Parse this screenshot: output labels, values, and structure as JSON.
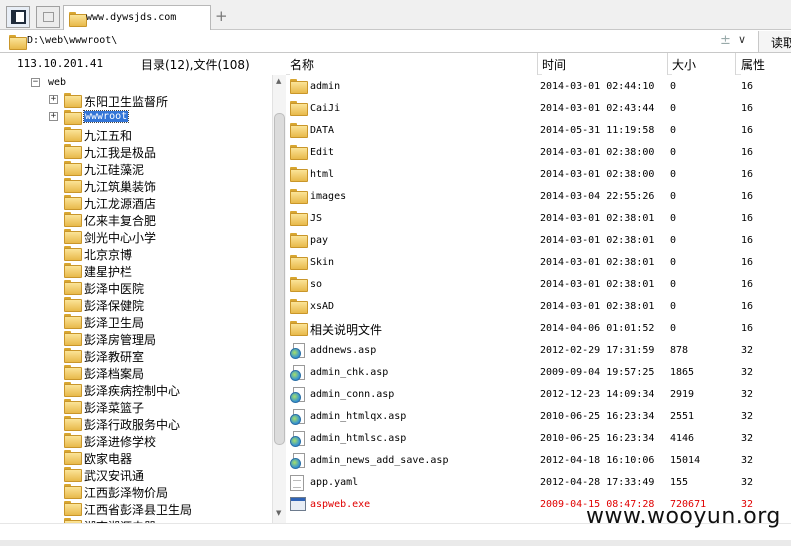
{
  "tab": {
    "title": "www.dywsjds.com",
    "add_symbol": "+"
  },
  "address": {
    "path": "D:\\web\\wwwroot\\",
    "pin_symbol": "±",
    "dropdown_symbol": "∨",
    "read_label": "读取"
  },
  "status": {
    "ip": "113.10.201.41",
    "summary": "目录(12),文件(108)"
  },
  "columns": {
    "name": "名称",
    "time": "时间",
    "size": "大小",
    "attr": "属性"
  },
  "tree": {
    "root": {
      "label": "web",
      "expander": "−"
    },
    "items": [
      {
        "label": "东阳卫生监督所",
        "expander": "+"
      },
      {
        "label": "wwwroot",
        "expander": "+",
        "selected": true
      },
      {
        "label": "九江五和"
      },
      {
        "label": "九江我是极品"
      },
      {
        "label": "九江硅藻泥"
      },
      {
        "label": "九江筑巢装饰"
      },
      {
        "label": "九江龙源酒店"
      },
      {
        "label": "亿来丰复合肥"
      },
      {
        "label": "剑光中心小学"
      },
      {
        "label": "北京京博"
      },
      {
        "label": "建星护栏"
      },
      {
        "label": "彭泽中医院"
      },
      {
        "label": "彭泽保健院"
      },
      {
        "label": "彭泽卫生局"
      },
      {
        "label": "彭泽房管理局"
      },
      {
        "label": "彭泽教研室"
      },
      {
        "label": "彭泽档案局"
      },
      {
        "label": "彭泽疾病控制中心"
      },
      {
        "label": "彭泽菜篮子"
      },
      {
        "label": "彭泽行政服务中心"
      },
      {
        "label": "彭泽进修学校"
      },
      {
        "label": "欧家电器"
      },
      {
        "label": "武汉安讯通"
      },
      {
        "label": "江西彭泽物价局"
      },
      {
        "label": "江西省彭泽县卫生局"
      },
      {
        "label": "湖南湘源电器"
      }
    ]
  },
  "files": [
    {
      "icon": "folder-icon",
      "name": "admin",
      "time": "2014-03-01 02:44:10",
      "size": "0",
      "attr": "16"
    },
    {
      "icon": "folder-icon",
      "name": "CaiJi",
      "time": "2014-03-01 02:43:44",
      "size": "0",
      "attr": "16"
    },
    {
      "icon": "folder-icon",
      "name": "DATA",
      "time": "2014-05-31 11:19:58",
      "size": "0",
      "attr": "16"
    },
    {
      "icon": "folder-icon",
      "name": "Edit",
      "time": "2014-03-01 02:38:00",
      "size": "0",
      "attr": "16"
    },
    {
      "icon": "folder-icon",
      "name": "html",
      "time": "2014-03-01 02:38:00",
      "size": "0",
      "attr": "16"
    },
    {
      "icon": "folder-icon",
      "name": "images",
      "time": "2014-03-04 22:55:26",
      "size": "0",
      "attr": "16"
    },
    {
      "icon": "folder-icon",
      "name": "JS",
      "time": "2014-03-01 02:38:01",
      "size": "0",
      "attr": "16"
    },
    {
      "icon": "folder-icon",
      "name": "pay",
      "time": "2014-03-01 02:38:01",
      "size": "0",
      "attr": "16"
    },
    {
      "icon": "folder-icon",
      "name": "Skin",
      "time": "2014-03-01 02:38:01",
      "size": "0",
      "attr": "16"
    },
    {
      "icon": "folder-icon",
      "name": "so",
      "time": "2014-03-01 02:38:01",
      "size": "0",
      "attr": "16"
    },
    {
      "icon": "folder-icon",
      "name": "xsAD",
      "time": "2014-03-01 02:38:01",
      "size": "0",
      "attr": "16"
    },
    {
      "icon": "folder-icon",
      "name": "相关说明文件",
      "time": "2014-04-06 01:01:52",
      "size": "0",
      "attr": "16",
      "cn": true
    },
    {
      "icon": "asp-file-icon",
      "name": "addnews.asp",
      "time": "2012-02-29 17:31:59",
      "size": "878",
      "attr": "32"
    },
    {
      "icon": "asp-file-icon",
      "name": "admin_chk.asp",
      "time": "2009-09-04 19:57:25",
      "size": "1865",
      "attr": "32"
    },
    {
      "icon": "asp-file-icon",
      "name": "admin_conn.asp",
      "time": "2012-12-23 14:09:34",
      "size": "2919",
      "attr": "32"
    },
    {
      "icon": "asp-file-icon",
      "name": "admin_htmlqx.asp",
      "time": "2010-06-25 16:23:34",
      "size": "2551",
      "attr": "32"
    },
    {
      "icon": "asp-file-icon",
      "name": "admin_htmlsc.asp",
      "time": "2010-06-25 16:23:34",
      "size": "4146",
      "attr": "32"
    },
    {
      "icon": "asp-file-icon",
      "name": "admin_news_add_save.asp",
      "time": "2012-04-18 16:10:06",
      "size": "15014",
      "attr": "32"
    },
    {
      "icon": "text-file-icon",
      "name": "app.yaml",
      "time": "2012-04-28 17:33:49",
      "size": "155",
      "attr": "32"
    },
    {
      "icon": "exe-file-icon",
      "name": "aspweb.exe",
      "time": "2009-04-15 08:47:28",
      "size": "720671",
      "attr": "32",
      "highlight": "#e00000"
    }
  ],
  "watermark": "www.wooyun.org",
  "colors": {
    "selection": "#3375d7",
    "highlight_red": "#e00000",
    "folder": "#e8b94a"
  }
}
